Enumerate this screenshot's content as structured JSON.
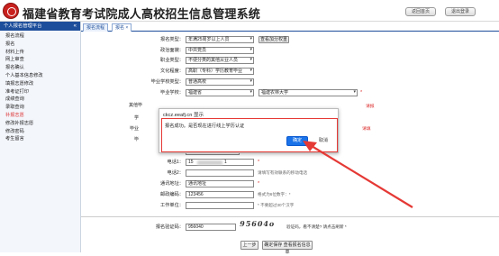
{
  "header": {
    "title": "福建省教育考试院成人高校招生信息管理系统",
    "btn_home": "返回首页",
    "btn_logout": "退出登录"
  },
  "sidebar": {
    "heading": "个人报名管理平台",
    "collapse": "«",
    "items": [
      {
        "label": "报名流程"
      },
      {
        "label": "报名"
      },
      {
        "label": "材料上传"
      },
      {
        "label": "网上审查"
      },
      {
        "label": "报名确认"
      },
      {
        "label": "个人基本信息修改"
      },
      {
        "label": "填报志愿修改"
      },
      {
        "label": "准考证打印"
      },
      {
        "label": "成绩查询"
      },
      {
        "label": "录取查询"
      },
      {
        "label": "补报志愿"
      },
      {
        "label": "修改补报志愿"
      },
      {
        "label": "修改密码"
      },
      {
        "label": "考生留言"
      }
    ],
    "active_index": 10
  },
  "tabs": [
    {
      "label": "报名流程"
    },
    {
      "label": "报名 ×"
    }
  ],
  "form": {
    "rows": [
      {
        "label": "报名类型：",
        "value": "年满25周岁以上人员",
        "button": "查看加分权重"
      },
      {
        "label": "政治面貌：",
        "value": "中共党员"
      },
      {
        "label": "职业类型：",
        "value": "不便分类的其他从业人员"
      },
      {
        "label": "文化程度：",
        "value": "高职（专科）学历教育毕业"
      },
      {
        "label": "毕业学校类型：",
        "value": "普通高校"
      },
      {
        "label": "毕业学校：",
        "value": "福建省",
        "value2": "福建农林大学"
      }
    ],
    "partial_label_1": "其他毕",
    "partial_red_1": "请报",
    "partial_label_2": "学",
    "partial_label_3": "毕业",
    "partial_red_3": "请填",
    "partial_label_4": "毕",
    "work_label": "工作时间：",
    "work_hint": "可以不填写，格式如yyyy-mm-dd",
    "phone1_label": "电话1：",
    "phone1_value": "15",
    "phone1_tail": "1",
    "phone2_label": "电话2：",
    "phone2_hint": "请填写有效联系的移动电话",
    "address_label": "通讯地址：",
    "address_value": "通讯地址",
    "postcode_label": "邮政编码：",
    "postcode_value": "123456",
    "postcode_hint": "格式为6位数字：*",
    "resume_label": "工作单位：",
    "resume_hint": "* 不要超过30个汉字",
    "captcha_label": "报名验证码：",
    "captcha_value": "956040",
    "captcha_image": "95604o",
    "captcha_hint": "验证码，看不清楚? 请点击刷新 *",
    "prev_button": "上一步",
    "next_button": "确定保存 查看报名信息单"
  },
  "dialog": {
    "title": "ckcz.eeafj.cn 显示",
    "message": "报名成功。是否现在进行线上学历认证",
    "ok": "确定",
    "cancel": "取消"
  },
  "colors": {
    "brand_blue": "#1d4e9b",
    "highlight_red": "#e53935",
    "ok_blue": "#1a73e8"
  }
}
